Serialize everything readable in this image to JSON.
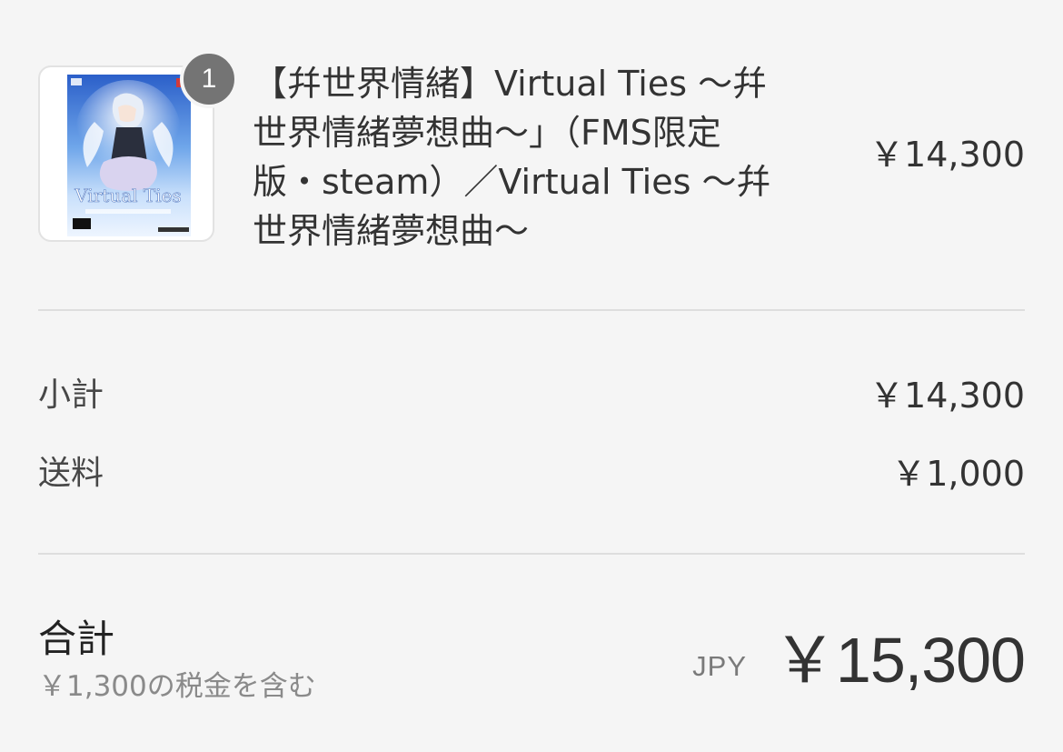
{
  "line_item": {
    "quantity": "1",
    "title": "【幷世界情緒】Virtual Ties 〜幷世界情緒夢想曲〜」（FMS限定版・steam）／Virtual Ties 〜幷世界情緒夢想曲〜",
    "price": "￥14,300",
    "thumbnail": {
      "icon": "product-cover-image",
      "cover_title": "Virtual Ties",
      "colors": [
        "#3d6fd1",
        "#9ec6f2",
        "#e9f3ff"
      ]
    }
  },
  "summary": {
    "subtotal_label": "小計",
    "subtotal_value": "￥14,300",
    "shipping_label": "送料",
    "shipping_value": "￥1,000"
  },
  "total": {
    "label": "合計",
    "tax_note": "￥1,300の税金を含む",
    "currency": "JPY",
    "value": "￥15,300"
  }
}
